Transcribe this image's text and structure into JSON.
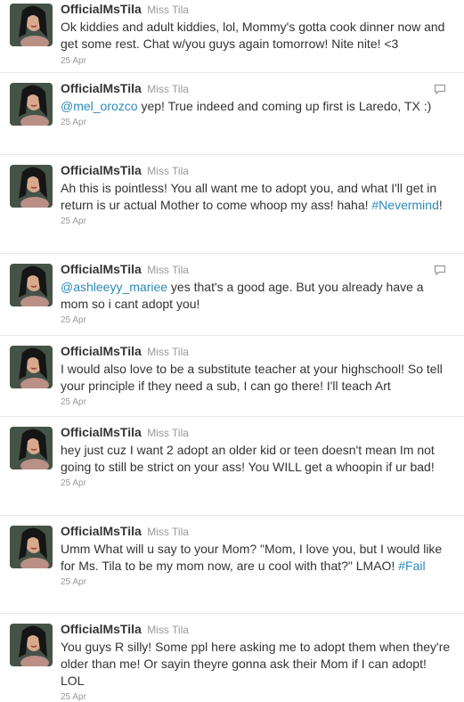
{
  "tweets": [
    {
      "name": "OfficialMsTila",
      "handle": "Miss Tila",
      "text": "Ok kiddies and adult kiddies, lol, Mommy's gotta cook dinner now and get some rest. Chat w/you guys again tomorrow! Nite nite! <3",
      "time": "25 Apr"
    },
    {
      "name": "OfficialMsTila",
      "handle": "Miss Tila",
      "mention": "@mel_orozco",
      "text": " yep! True indeed and coming up first is Laredo, TX :)",
      "time": "25 Apr"
    },
    {
      "name": "OfficialMsTila",
      "handle": "Miss Tila",
      "text": "Ah this is pointless! You all want me to adopt you, and what I'll get in return is ur actual Mother to come whoop my ass! haha! ",
      "hashtag": "#Nevermind",
      "text_after": "!",
      "time": "25 Apr"
    },
    {
      "name": "OfficialMsTila",
      "handle": "Miss Tila",
      "mention": "@ashleeyy_mariee",
      "text": " yes that's a good age. But you already have a mom so i cant adopt you!",
      "time": "25 Apr"
    },
    {
      "name": "OfficialMsTila",
      "handle": "Miss Tila",
      "text": "I would also love to be a substitute teacher at your highschool! So tell your principle if they need a sub, I can go there! I'll teach Art",
      "time": "25 Apr"
    },
    {
      "name": "OfficialMsTila",
      "handle": "Miss Tila",
      "text": "hey just cuz I want 2 adopt an older kid or teen doesn't mean Im not going to still be strict on your ass! You WILL get a whoopin if ur bad!",
      "time": "25 Apr"
    },
    {
      "name": "OfficialMsTila",
      "handle": "Miss Tila",
      "text": "Umm What will u say to your Mom? \"Mom, I love you, but I would like for Ms. Tila to be my mom now, are u cool with that?\" LMAO! ",
      "hashtag": "#Fail",
      "time": "25 Apr"
    },
    {
      "name": "OfficialMsTila",
      "handle": "Miss Tila",
      "text": "You guys R silly! Some ppl here asking me to adopt them when they're older than me! Or sayin theyre gonna ask their Mom if I can adopt! LOL",
      "time": "25 Apr"
    }
  ],
  "icons": {
    "avatar": "profile-photo",
    "reply": "reply-speech-bubble-icon"
  },
  "colors": {
    "link": "#2a8ab8",
    "meta": "#999999",
    "text": "#333333",
    "divider": "#e8e8e8"
  }
}
